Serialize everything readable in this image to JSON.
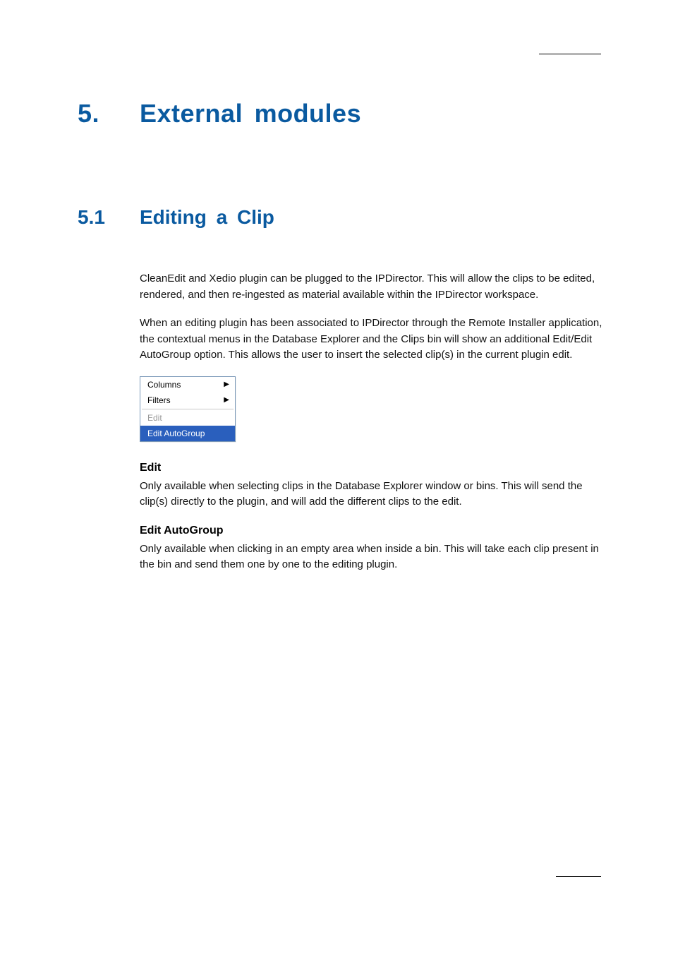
{
  "heading1": {
    "number": "5.",
    "title": "External modules"
  },
  "heading2": {
    "number": "5.1",
    "title": "Editing a Clip"
  },
  "intro": {
    "p1": "CleanEdit and Xedio plugin can be plugged to the IPDirector. This will allow the clips to be edited, rendered, and then re-ingested as material available within the IPDirector workspace.",
    "p2": "When an editing plugin has been associated to IPDirector through the Remote Installer application, the contextual menus in the Database Explorer and the Clips bin will show an additional Edit/Edit AutoGroup option. This allows the user to insert the selected clip(s) in the current plugin edit."
  },
  "context_menu": {
    "items": [
      {
        "label": "Columns",
        "has_submenu": true,
        "disabled": false,
        "highlight": false
      },
      {
        "label": "Filters",
        "has_submenu": true,
        "disabled": false,
        "highlight": false
      }
    ],
    "items2": [
      {
        "label": "Edit",
        "has_submenu": false,
        "disabled": true,
        "highlight": false
      },
      {
        "label": "Edit AutoGroup",
        "has_submenu": false,
        "disabled": false,
        "highlight": true
      }
    ]
  },
  "terms": {
    "edit": {
      "label": "Edit",
      "desc": "Only available when selecting clips in the Database Explorer window or bins. This will send the clip(s) directly to the plugin, and will add the different clips to the edit."
    },
    "edit_autogroup": {
      "label": "Edit AutoGroup",
      "desc": "Only available when clicking in an empty area when inside a bin. This will take each clip present in the bin and send them one by one to the editing plugin."
    }
  }
}
